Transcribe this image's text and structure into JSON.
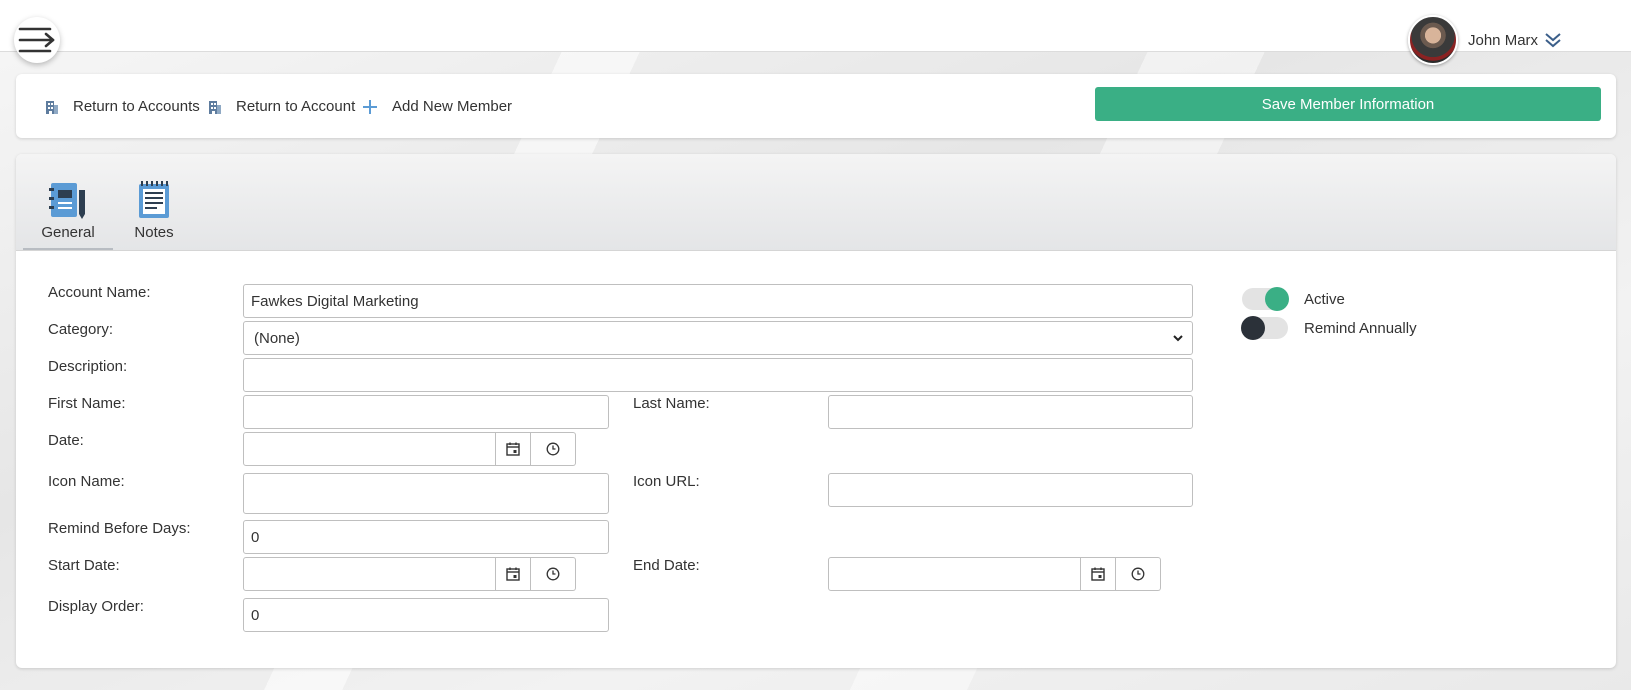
{
  "topbar": {
    "user_name": "John Marx"
  },
  "actions": {
    "return_accounts": "Return to Accounts",
    "return_account": "Return to Account",
    "add_member": "Add New Member",
    "save": "Save Member Information"
  },
  "tabs": [
    {
      "label": "General",
      "active": true
    },
    {
      "label": "Notes",
      "active": false
    }
  ],
  "form": {
    "account_name_label": "Account Name:",
    "account_name_value": "Fawkes Digital Marketing",
    "category_label": "Category:",
    "category_value": "(None)",
    "description_label": "Description:",
    "description_value": "",
    "first_name_label": "First Name:",
    "first_name_value": "",
    "last_name_label": "Last Name:",
    "last_name_value": "",
    "date_label": "Date:",
    "icon_name_label": "Icon Name:",
    "icon_name_value": "",
    "icon_url_label": "Icon URL:",
    "icon_url_value": "",
    "remind_before_label": "Remind Before Days:",
    "remind_before_value": "0",
    "start_date_label": "Start Date:",
    "end_date_label": "End Date:",
    "display_order_label": "Display Order:",
    "display_order_value": "0"
  },
  "toggles": {
    "active_label": "Active",
    "active_on": true,
    "remind_label": "Remind Annually",
    "remind_on": false
  },
  "colors": {
    "accent": "#3aaf85",
    "dark_knob": "#2b3139"
  }
}
